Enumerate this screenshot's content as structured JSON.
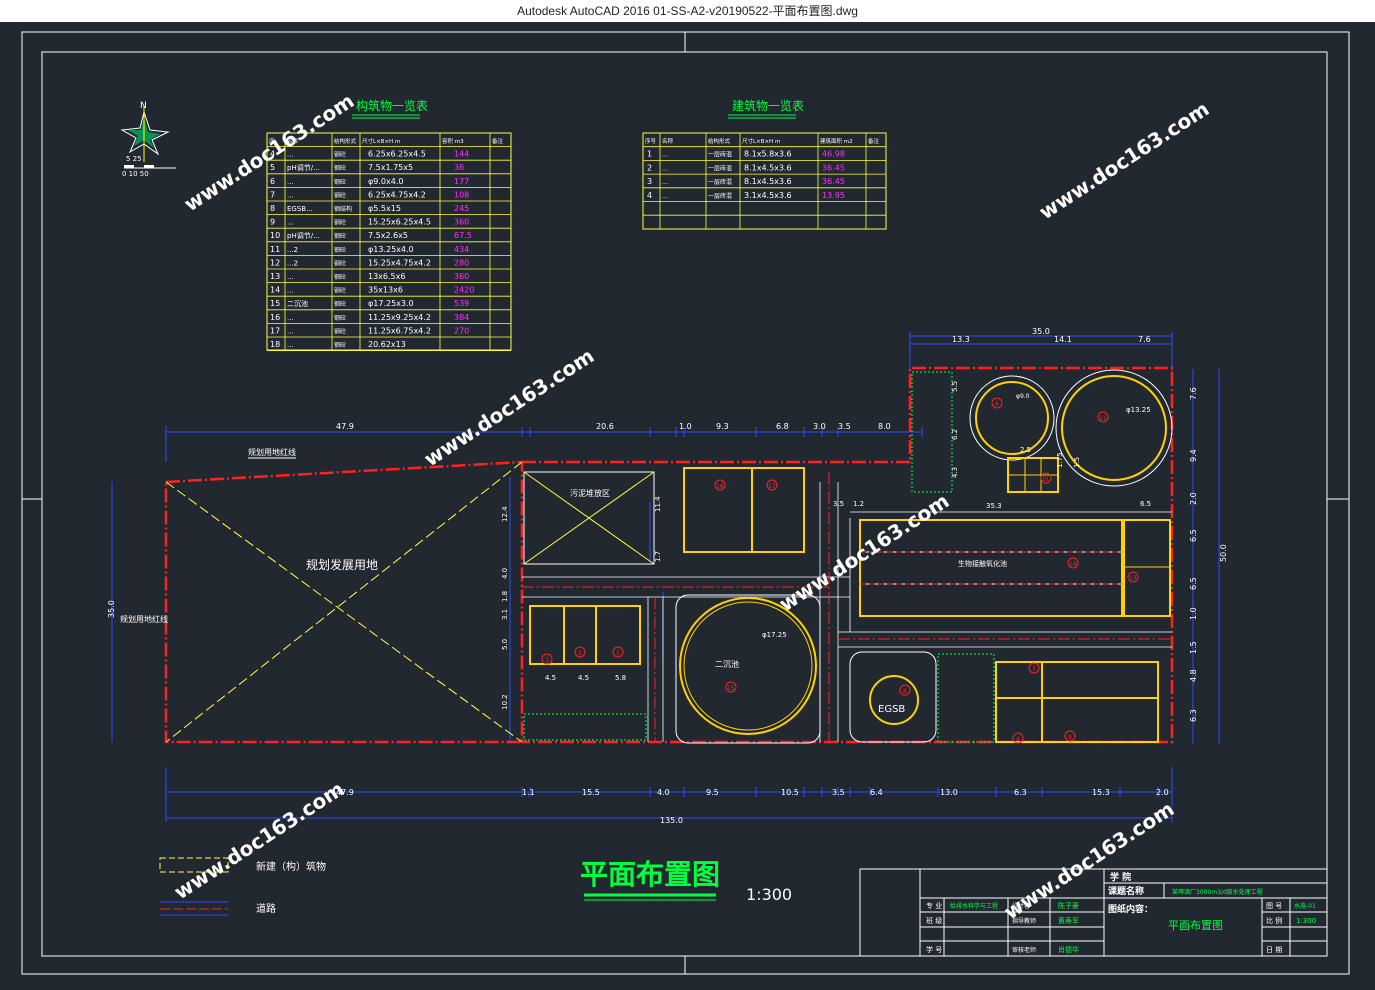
{
  "window": {
    "title": "Autodesk AutoCAD 2016    01-SS-A2-v20190522-平面布置图.dwg"
  },
  "drawing": {
    "main_title": "平面布置图",
    "scale": "1:300",
    "watermark": "www.doc163.com",
    "north_label": "N",
    "scale_bar_top": "5  25",
    "scale_bar_bottom": "0 10          50"
  },
  "structures_table": {
    "title": "构筑物一览表",
    "headers": [
      "序",
      "名称",
      "结构形式",
      "尺寸L×B×H m",
      "容积 m3",
      "备注"
    ],
    "rows": [
      {
        "no": "4",
        "name": "...",
        "form": "钢砼",
        "size": "6.25x6.25x4.5",
        "vol": "144"
      },
      {
        "no": "5",
        "name": "pH调节/...",
        "form": "钢砼",
        "size": "7.5x1.75x5",
        "vol": "36"
      },
      {
        "no": "6",
        "name": "...",
        "form": "钢砼",
        "size": "φ9.0x4.0",
        "vol": "177"
      },
      {
        "no": "7",
        "name": "...",
        "form": "钢砼",
        "size": "6.25x4.75x4.2",
        "vol": "108"
      },
      {
        "no": "8",
        "name": "EGSB...",
        "form": "钢结构",
        "size": "φ5.5x15",
        "vol": "245"
      },
      {
        "no": "9",
        "name": "...",
        "form": "钢砼",
        "size": "15.25x6.25x4.5",
        "vol": "360"
      },
      {
        "no": "10",
        "name": "pH调节/...",
        "form": "钢砼",
        "size": "7.5x2.6x5",
        "vol": "67.5"
      },
      {
        "no": "11",
        "name": "...2",
        "form": "钢砼",
        "size": "φ13.25x4.0",
        "vol": "434"
      },
      {
        "no": "12",
        "name": "...2",
        "form": "钢砼",
        "size": "15.25x4.75x4.2",
        "vol": "280"
      },
      {
        "no": "13",
        "name": "...",
        "form": "钢砼",
        "size": "13x6.5x6",
        "vol": "360"
      },
      {
        "no": "14",
        "name": "...",
        "form": "钢砼",
        "size": "35x13x6",
        "vol": "2420"
      },
      {
        "no": "15",
        "name": "二沉池",
        "form": "钢砼",
        "size": "φ17.25x3.0",
        "vol": "539"
      },
      {
        "no": "16",
        "name": "...",
        "form": "钢砼",
        "size": "11.25x9.25x4.2",
        "vol": "384"
      },
      {
        "no": "17",
        "name": "...",
        "form": "钢砼",
        "size": "11.25x6.75x4.2",
        "vol": "270"
      },
      {
        "no": "18",
        "name": "...",
        "form": "钢砼",
        "size": "20.62x13",
        "vol": ""
      }
    ]
  },
  "buildings_table": {
    "title": "建筑物一览表",
    "headers": [
      "序号",
      "名称",
      "结构形式",
      "尺寸L×B×H m",
      "建筑面积 m2",
      "备注"
    ],
    "rows": [
      {
        "no": "1",
        "name": "...",
        "form": "一层砖混",
        "size": "8.1x5.8x3.6",
        "area": "46.98"
      },
      {
        "no": "2",
        "name": "...",
        "form": "一层砖混",
        "size": "8.1x4.5x3.6",
        "area": "36.45"
      },
      {
        "no": "3",
        "name": "...",
        "form": "一层砖混",
        "size": "8.1x4.5x3.6",
        "area": "36.45"
      },
      {
        "no": "4",
        "name": "...",
        "form": "一层砖混",
        "size": "3.1x4.5x3.6",
        "area": "13.95"
      }
    ]
  },
  "dimensions": {
    "top_left": [
      "47.9",
      "20.6",
      "1.0",
      "9.3",
      "6.8",
      "3.0",
      "3.5",
      "8.0"
    ],
    "top_right_total": "35.0",
    "top_right": [
      "13.3",
      "14.1",
      "7.6"
    ],
    "right_side": [
      "7.6",
      "9.4",
      "2.0",
      "6.5",
      "6.5",
      "1.0",
      "1.5",
      "4.8",
      "6.3"
    ],
    "right_total": "50.0",
    "bottom": [
      "47.9",
      "1.1",
      "15.5",
      "4.0",
      "9.5",
      "10.5",
      "3.5",
      "6.4",
      "13.0",
      "6.3",
      "15.3",
      "2.0"
    ],
    "bottom_total": "135.0",
    "left_total": "35.0",
    "inner": [
      "12.4",
      "4.0",
      "1.8",
      "3.1",
      "5.0",
      "10.2",
      "11.4",
      "1.7",
      "3.5",
      "1.2",
      "35.3",
      "6.5",
      "4.5",
      "4.5",
      "5.8",
      "5.5",
      "6.2",
      "4.3",
      "2.5",
      "1.75",
      "1.5"
    ]
  },
  "plan_labels": {
    "planned_land": "规划发展用地",
    "boundary_top": "规划用地红线",
    "boundary_left": "规划用地红线",
    "sludge_yard": "污泥堆放区",
    "secondary_clarifier": "二沉池",
    "egsb": "EGSB",
    "aeration_tank": "生物接触氧化池",
    "tag_15": "15",
    "tag_8": "8",
    "tag_11": "11",
    "tag_14": "14",
    "tag_13": "13",
    "tag_16": "16",
    "tag_17": "17",
    "tag_1": "1",
    "tag_2": "2",
    "tag_3": "3",
    "tag_4": "4",
    "tag_6": "6",
    "tag_7": "7",
    "tag_9": "9",
    "tag_10": "10",
    "phi_15": "φ17.25",
    "phi_11": "φ13.25",
    "phi_6": "φ9.0"
  },
  "legend": {
    "new_building": "新建（构）筑物",
    "road": "道路"
  },
  "title_block": {
    "school_label": "学  院",
    "project_label": "课题名称",
    "project_value": "某啤酒厂3000m3/d废水处理工程",
    "drawing_content_label": "图纸内容：",
    "drawing_content_value": "平面布置图",
    "rows": [
      {
        "label": "专 业",
        "value": "给排水科学与工程",
        "label2": "设计者",
        "value2": "陈子豪"
      },
      {
        "label": "班 级",
        "value": "",
        "label2": "指导教师",
        "value2": "黄寿军"
      },
      {
        "label": "学 号",
        "value": "",
        "label2": "审核老师",
        "value2": "肖德华"
      }
    ],
    "right_labels": [
      "图 号",
      "比 例",
      "日 期"
    ],
    "right_values": [
      "水施-01",
      "1:300",
      ""
    ]
  },
  "colors": {
    "background": "#212830",
    "frame": "#ffffff",
    "dimension": "#2f4dff",
    "boundary": "#ff2020",
    "structure": "#ffd200",
    "road": "#0a2bff",
    "table_border": "#ffff40",
    "volume_text": "#ff30ff",
    "green": "#00ff40",
    "watermark": "#ffffff"
  }
}
